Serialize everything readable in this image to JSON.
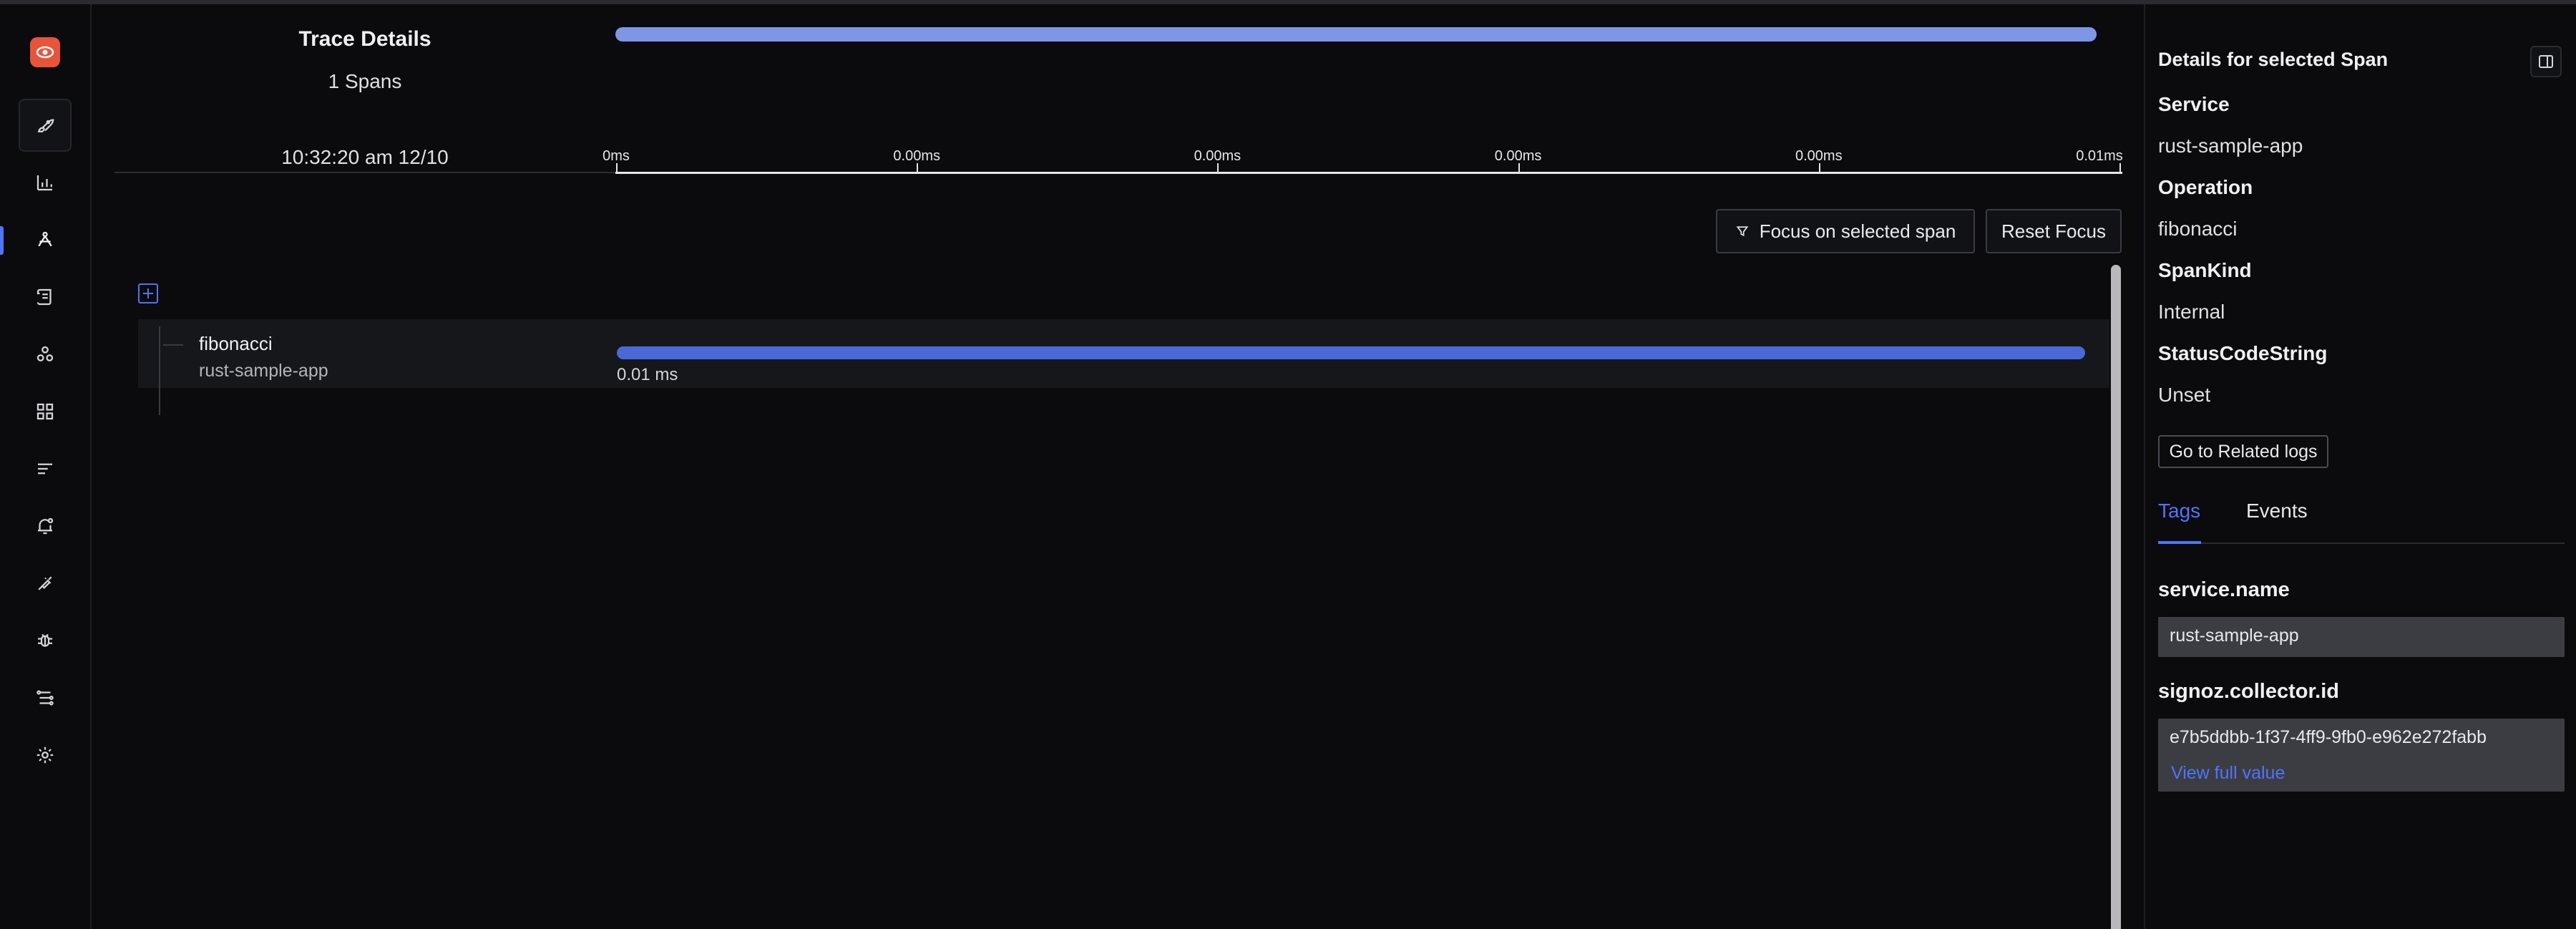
{
  "app": {
    "accent_color": "#4e74f8",
    "logo_color": "#e8543a"
  },
  "sidebar": {
    "items": [
      {
        "name": "rocket-icon",
        "active": false,
        "boxed": true
      },
      {
        "name": "bar-chart-icon",
        "active": false
      },
      {
        "name": "traces-icon",
        "active": true
      },
      {
        "name": "logs-icon",
        "active": false
      },
      {
        "name": "services-map-icon",
        "active": false
      },
      {
        "name": "dashboard-grid-icon",
        "active": false
      },
      {
        "name": "messaging-queues-icon",
        "active": false
      },
      {
        "name": "alerts-bell-icon",
        "active": false
      },
      {
        "name": "integrations-plug-icon",
        "active": false
      },
      {
        "name": "exceptions-bug-icon",
        "active": false
      },
      {
        "name": "pipelines-icon",
        "active": false
      },
      {
        "name": "settings-gear-icon",
        "active": false
      }
    ]
  },
  "trace": {
    "title": "Trace Details",
    "span_count": "1 Spans",
    "start_time": "10:32:20 am 12/10"
  },
  "timeline": {
    "ticks": [
      "0ms",
      "0.00ms",
      "0.00ms",
      "0.00ms",
      "0.00ms",
      "0.01ms"
    ]
  },
  "actions": {
    "focus_label": "Focus on selected span",
    "reset_label": "Reset Focus"
  },
  "span": {
    "operation": "fibonacci",
    "service": "rust-sample-app",
    "duration": "0.01 ms",
    "bar_color": "#4a68d8",
    "bar_fraction": 1.0
  },
  "details": {
    "title": "Details for selected Span",
    "service_label": "Service",
    "service_value": "rust-sample-app",
    "operation_label": "Operation",
    "operation_value": "fibonacci",
    "spankind_label": "SpanKind",
    "spankind_value": "Internal",
    "status_label": "StatusCodeString",
    "status_value": "Unset",
    "related_logs_label": "Go to Related logs",
    "tabs": {
      "tags": "Tags",
      "events": "Events",
      "active": "Tags"
    },
    "tags": [
      {
        "key": "service.name",
        "value": "rust-sample-app"
      },
      {
        "key": "signoz.collector.id",
        "value": "e7b5ddbb-1f37-4ff9-9fb0-e962e272fabb",
        "link": "View full value"
      }
    ]
  }
}
